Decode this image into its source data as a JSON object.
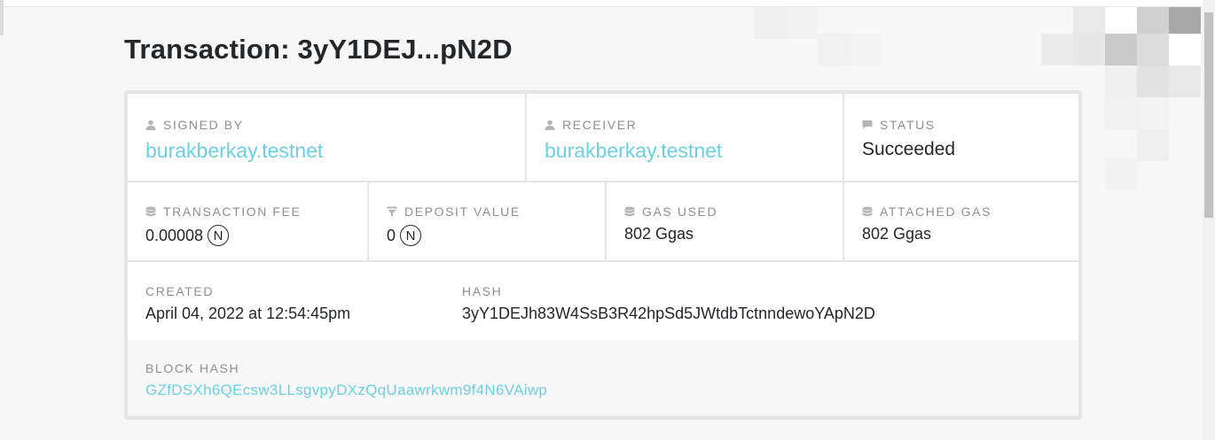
{
  "page": {
    "title": "Transaction: 3yY1DEJ...pN2D"
  },
  "signed_by": {
    "label": "SIGNED BY",
    "value": "burakberkay.testnet",
    "icon": "user-icon"
  },
  "receiver": {
    "label": "RECEIVER",
    "value": "burakberkay.testnet",
    "icon": "user-icon"
  },
  "status": {
    "label": "STATUS",
    "value": "Succeeded",
    "icon": "comment-icon"
  },
  "transaction_fee": {
    "label": "TRANSACTION FEE",
    "value": "0.00008",
    "unit": "N",
    "icon": "database-icon"
  },
  "deposit_value": {
    "label": "DEPOSIT VALUE",
    "value": "0",
    "unit": "N",
    "icon": "filter-icon"
  },
  "gas_used": {
    "label": "GAS USED",
    "value": "802 Ggas",
    "icon": "database-icon"
  },
  "attached_gas": {
    "label": "ATTACHED GAS",
    "value": "802 Ggas",
    "icon": "database-icon"
  },
  "created": {
    "label": "CREATED",
    "value": "April 04, 2022 at 12:54:45pm"
  },
  "hash": {
    "label": "HASH",
    "value": "3yY1DEJh83W4SsB3R42hpSd5JWtdbTctnndewoYApN2D"
  },
  "block_hash": {
    "label": "BLOCK HASH",
    "value": "GZfDSXh6QEcsw3LLsgvpyDXzQqUaawrkwm9f4N6VAiwp"
  },
  "colors": {
    "accent": "#6ad1e3",
    "text": "#24272a",
    "muted": "#8e8f91",
    "border": "#e5e5e5"
  }
}
